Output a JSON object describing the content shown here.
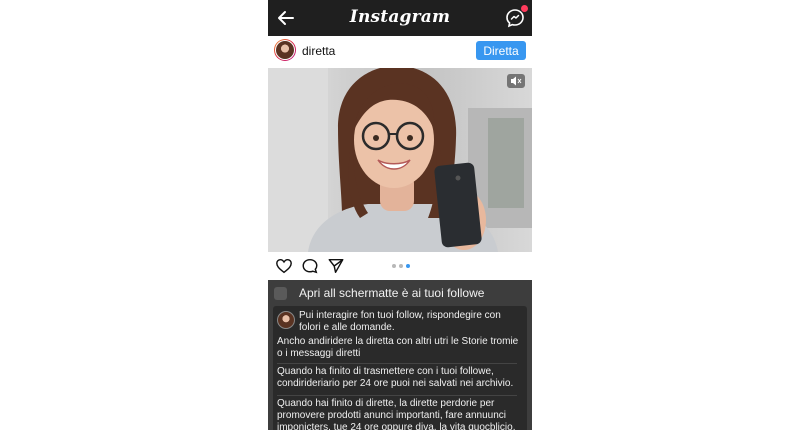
{
  "app": {
    "title": "Instagram"
  },
  "header": {
    "back_icon": "arrow-left-icon",
    "dm_icon": "messenger-icon",
    "notification_color": "#ff3b5c"
  },
  "post": {
    "username": "diretta",
    "action_button": "Diretta",
    "accent_color": "#3897f0",
    "carousel": {
      "total": 3,
      "active_index": 2
    }
  },
  "actions": {
    "like_icon": "heart-icon",
    "comment_icon": "comment-icon",
    "share_icon": "send-icon"
  },
  "panel": {
    "title": "Apri all schermatte è ai tuoi followe",
    "paragraphs": [
      "Pui interagire fon tuoi follow, rispondegire con folori e alle domande.",
      "Ancho andiridere la diretta con altri utri le Storie tromie o i messaggi diretti",
      "Quando ha finito di trasmettere con i tuoi followe, condirideriario per 24 ore puoi nei salvati nei archivio.",
      "Quando hai finito di dirette, la dirette perdorie per promovere prodotti anunci importanti, fare annuunci imponicters, tue 24 ore oppure diva, la vita quocblicio."
    ]
  }
}
